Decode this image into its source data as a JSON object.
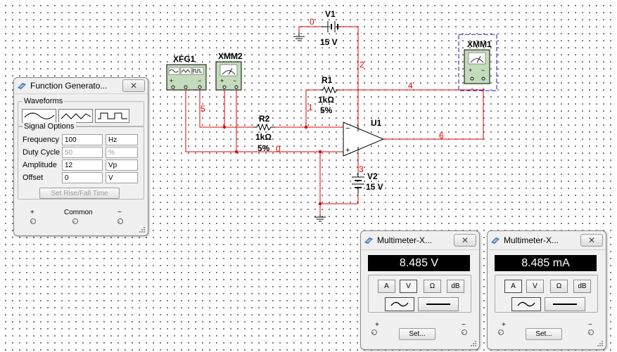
{
  "circuit": {
    "components": {
      "v1": {
        "ref": "V1",
        "value": "15 V"
      },
      "v2": {
        "ref": "V2",
        "value": "15 V"
      },
      "r1": {
        "ref": "R1",
        "value": "1kΩ",
        "tolerance": "5%"
      },
      "r2": {
        "ref": "R2",
        "value": "1kΩ",
        "tolerance": "5%"
      },
      "u1": {
        "ref": "U1"
      },
      "xfg1": {
        "ref": "XFG1"
      },
      "xmm1": {
        "ref": "XMM1"
      },
      "xmm2": {
        "ref": "XMM2"
      }
    },
    "nodes": {
      "n0a": "0",
      "n0b": "0",
      "n1": "1",
      "n2": "2",
      "n3": "3",
      "n4": "4",
      "n5": "5",
      "n6": "6"
    },
    "wire_color": "#e00000",
    "instrument_green": "#c4dcbc",
    "xmm1_selection_color": "#1a1aa0"
  },
  "function_generator": {
    "title": "Function Generato...",
    "close_glyph": "✕",
    "waveforms_label": "Waveforms",
    "waveform_icons": [
      "sine-wave-icon",
      "triangle-wave-icon",
      "square-wave-icon"
    ],
    "signal_options_label": "Signal Options",
    "fields": [
      {
        "label": "Frequency",
        "value": "100",
        "unit": "Hz",
        "enabled": true
      },
      {
        "label": "Duty Cycle",
        "value": "50",
        "unit": "%",
        "enabled": false
      },
      {
        "label": "Amplitude",
        "value": "12",
        "unit": "Vp",
        "enabled": true
      },
      {
        "label": "Offset",
        "value": "0",
        "unit": "V",
        "enabled": true
      }
    ],
    "rise_fall_button": "Set Rise/Fall Time",
    "terminals": {
      "plus": "+",
      "common": "Common",
      "minus": "−"
    }
  },
  "multimeters": [
    {
      "title": "Multimeter-X...",
      "close_glyph": "✕",
      "reading": "8.485 V",
      "modes": [
        "A",
        "V",
        "Ω",
        "dB"
      ],
      "active_mode": "V",
      "coupling": [
        "ac-wave-icon",
        "dc-line-icon"
      ],
      "active_coupling": "ac-wave-icon",
      "set_button": "Set...",
      "plus": "+",
      "minus": "−"
    },
    {
      "title": "Multimeter-X...",
      "close_glyph": "✕",
      "reading": "8.485 mA",
      "modes": [
        "A",
        "V",
        "Ω",
        "dB"
      ],
      "active_mode": "A",
      "coupling": [
        "ac-wave-icon",
        "dc-line-icon"
      ],
      "active_coupling": "ac-wave-icon",
      "set_button": "Set...",
      "plus": "+",
      "minus": "−"
    }
  ]
}
